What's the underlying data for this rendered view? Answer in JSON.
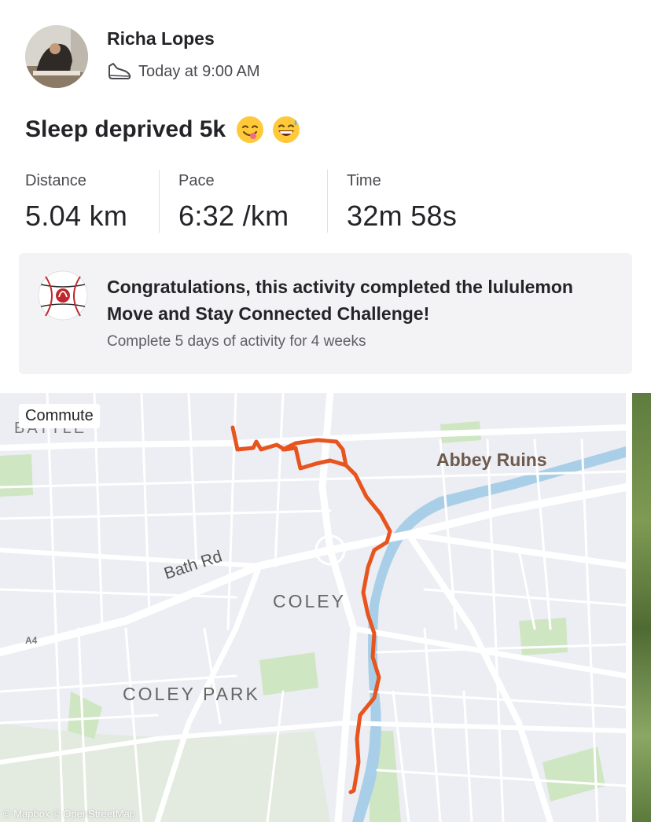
{
  "athlete": {
    "name": "Richa Lopes",
    "activity_icon": "shoe-icon",
    "timestamp": "Today at 9:00 AM"
  },
  "activity": {
    "title": "Sleep deprived 5k",
    "emojis": [
      "face-savoring-food-emoji",
      "grinning-sweat-emoji"
    ]
  },
  "stats": [
    {
      "label": "Distance",
      "value": "5.04 km"
    },
    {
      "label": "Pace",
      "value": "6:32 /km"
    },
    {
      "label": "Time",
      "value": "32m 58s"
    }
  ],
  "challenge": {
    "badge_icon": "lululemon-badge-icon",
    "title": "Congratulations, this activity completed the lululemon Move and Stay Connected Challenge!",
    "subtitle": "Complete 5 days of activity for 4 weeks"
  },
  "map": {
    "tag": "Commute",
    "labels": {
      "abbey": "Abbey Ruins",
      "bath_rd": "Bath Rd",
      "coley": "COLEY",
      "coley_park": "COLEY PARK",
      "a4": "A4",
      "battle": "BATTLE"
    },
    "attribution": "© Mapbox © OpenStreetMap",
    "route_color": "#e8541e",
    "river_color": "#a9cfe8",
    "park_color": "#cbe5bf"
  },
  "colors": {
    "card_bg": "#f3f3f5",
    "text_primary": "#242428",
    "text_secondary": "#494950"
  }
}
